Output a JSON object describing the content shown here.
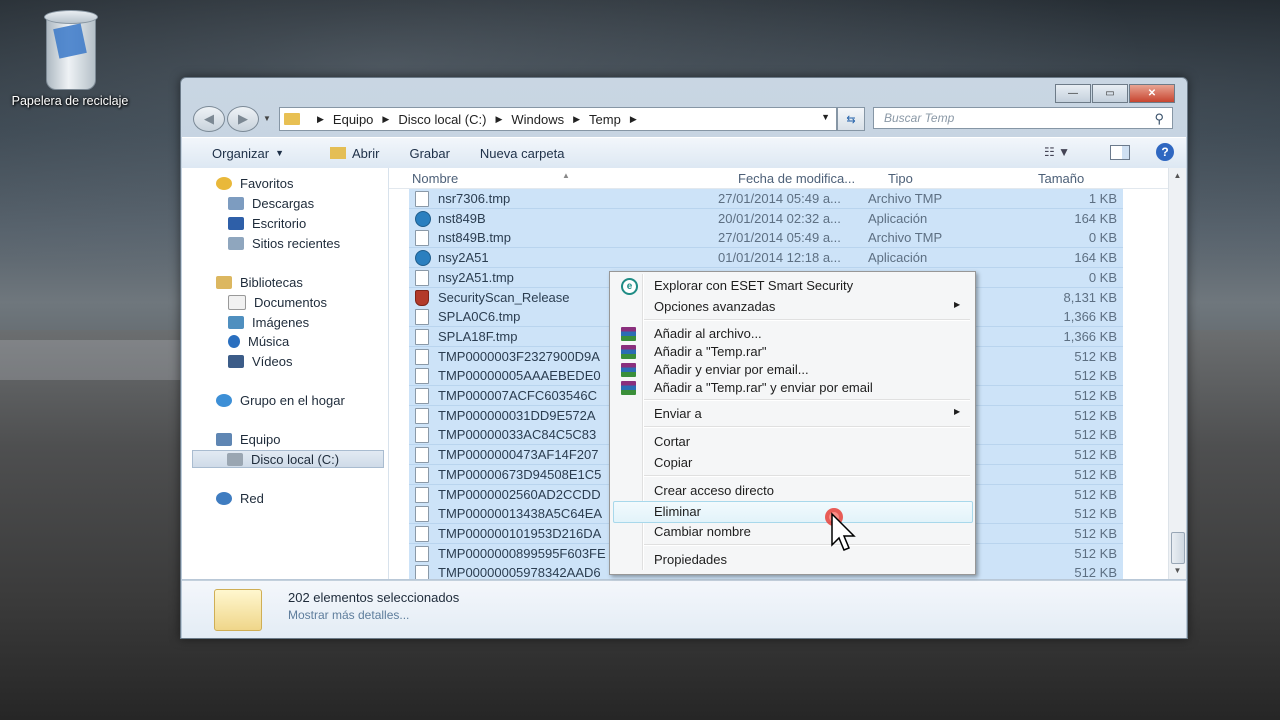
{
  "desktop": {
    "recycle_bin_label": "Papelera de reciclaje"
  },
  "window": {
    "caption_buttons": [
      "minimize",
      "maximize",
      "close"
    ],
    "address": {
      "crumbs": [
        "Equipo",
        "Disco local (C:)",
        "Windows",
        "Temp"
      ]
    },
    "search_placeholder": "Buscar Temp",
    "toolbar": {
      "organize": "Organizar",
      "open": "Abrir",
      "burn": "Grabar",
      "new_folder": "Nueva carpeta"
    },
    "nav": {
      "favorites": "Favoritos",
      "downloads": "Descargas",
      "desktop": "Escritorio",
      "recent": "Sitios recientes",
      "libraries": "Bibliotecas",
      "documents": "Documentos",
      "images": "Imágenes",
      "music": "Música",
      "videos": "Vídeos",
      "homegroup": "Grupo en el hogar",
      "computer": "Equipo",
      "local_disk": "Disco local (C:)",
      "network": "Red"
    },
    "columns": {
      "name": "Nombre",
      "date": "Fecha de modifica...",
      "type": "Tipo",
      "size": "Tamaño"
    },
    "files": [
      {
        "name": "nsr7306.tmp",
        "date": "27/01/2014 05:49 a...",
        "type": "Archivo TMP",
        "size": "1 KB",
        "icon": "file-icon"
      },
      {
        "name": "nst849B",
        "date": "20/01/2014 02:32 a...",
        "type": "Aplicación",
        "size": "164 KB",
        "icon": "app-icon"
      },
      {
        "name": "nst849B.tmp",
        "date": "27/01/2014 05:49 a...",
        "type": "Archivo TMP",
        "size": "0 KB",
        "icon": "file-icon"
      },
      {
        "name": "nsy2A51",
        "date": "01/01/2014 12:18 a...",
        "type": "Aplicación",
        "size": "164 KB",
        "icon": "app-icon"
      },
      {
        "name": "nsy2A51.tmp",
        "date": "",
        "type": "",
        "size": "0 KB",
        "icon": "file-icon"
      },
      {
        "name": "SecurityScan_Release",
        "date": "",
        "type": "",
        "size": "8,131 KB",
        "icon": "shield-icon"
      },
      {
        "name": "SPLA0C6.tmp",
        "date": "",
        "type": "",
        "size": "1,366 KB",
        "icon": "file-icon"
      },
      {
        "name": "SPLA18F.tmp",
        "date": "",
        "type": "",
        "size": "1,366 KB",
        "icon": "file-icon"
      },
      {
        "name": "TMP0000003F2327900D9A",
        "date": "",
        "type": "",
        "size": "512 KB",
        "icon": "file-icon"
      },
      {
        "name": "TMP00000005AAAEBEDE0",
        "date": "",
        "type": "",
        "size": "512 KB",
        "icon": "file-icon"
      },
      {
        "name": "TMP000007ACFC603546C",
        "date": "",
        "type": "",
        "size": "512 KB",
        "icon": "file-icon"
      },
      {
        "name": "TMP000000031DD9E572A",
        "date": "",
        "type": "",
        "size": "512 KB",
        "icon": "file-icon"
      },
      {
        "name": "TMP00000033AC84C5C83",
        "date": "",
        "type": "",
        "size": "512 KB",
        "icon": "file-icon"
      },
      {
        "name": "TMP0000000473AF14F207",
        "date": "",
        "type": "",
        "size": "512 KB",
        "icon": "file-icon"
      },
      {
        "name": "TMP00000673D94508E1C5",
        "date": "",
        "type": "",
        "size": "512 KB",
        "icon": "file-icon"
      },
      {
        "name": "TMP0000002560AD2CCDD",
        "date": "",
        "type": "",
        "size": "512 KB",
        "icon": "file-icon"
      },
      {
        "name": "TMP00000013438A5C64EA",
        "date": "",
        "type": "",
        "size": "512 KB",
        "icon": "file-icon"
      },
      {
        "name": "TMP000000101953D216DA",
        "date": "",
        "type": "",
        "size": "512 KB",
        "icon": "file-icon"
      },
      {
        "name": "TMP0000000899595F603FE",
        "date": "",
        "type": "",
        "size": "512 KB",
        "icon": "file-icon"
      },
      {
        "name": "TMP00000005978342AAD6",
        "date": "",
        "type": "",
        "size": "512 KB",
        "icon": "file-icon"
      }
    ],
    "details": {
      "count": "202 elementos seleccionados",
      "more": "Mostrar más detalles..."
    }
  },
  "context_menu": {
    "eset": "Explorar con ESET Smart Security",
    "advanced": "Opciones avanzadas",
    "add_archive": "Añadir al archivo...",
    "add_temp_rar": "Añadir a \"Temp.rar\"",
    "add_email": "Añadir y enviar por email...",
    "add_temp_rar_email": "Añadir a \"Temp.rar\" y enviar por email",
    "send_to": "Enviar a",
    "cut": "Cortar",
    "copy": "Copiar",
    "shortcut": "Crear acceso directo",
    "delete": "Eliminar",
    "rename": "Cambiar nombre",
    "properties": "Propiedades"
  }
}
